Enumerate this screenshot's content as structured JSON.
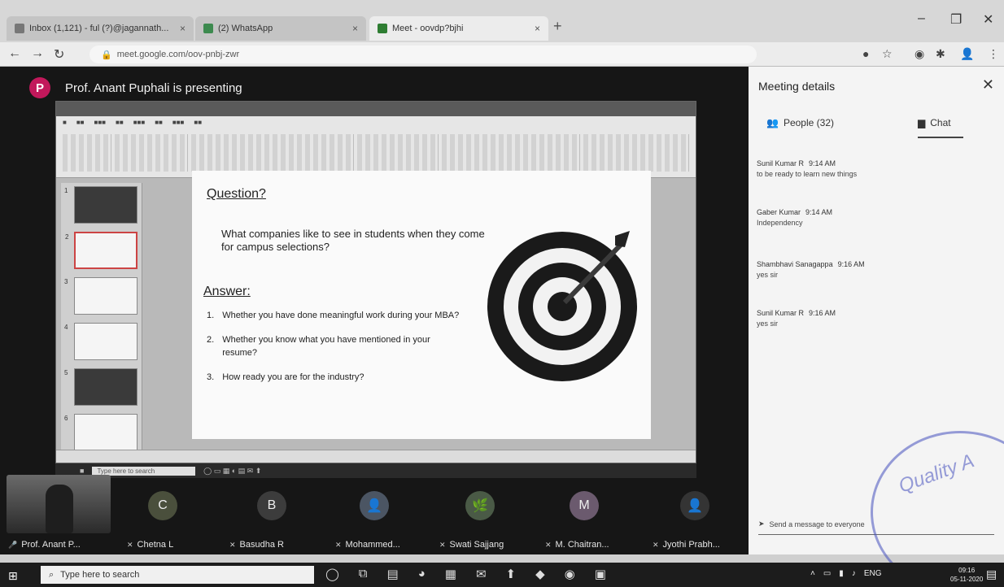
{
  "browser": {
    "tabs": [
      {
        "label": "Inbox (1,121) - ful (?)@jagannath...",
        "active": false
      },
      {
        "label": "(2) WhatsApp",
        "active": false
      },
      {
        "label": "Meet - oovdp?bjhi",
        "active": true
      }
    ],
    "url": "meet.google.com/oov-pnbj-zwr"
  },
  "meet": {
    "presenter_initial": "P",
    "presenter_color": "#c2185b",
    "presenting_text": "Prof. Anant Puphali is presenting"
  },
  "slide": {
    "question_heading": "Question?",
    "question_text": "What companies like to see in students when they come for campus selections?",
    "answer_heading": "Answer:",
    "answers": [
      {
        "num": "1.",
        "text": "Whether you have done meaningful work during your MBA?"
      },
      {
        "num": "2.",
        "text": "Whether you know what you have mentioned in your resume?"
      },
      {
        "num": "3.",
        "text": "How ready you are for the industry?"
      }
    ],
    "remote_search": "Type here to search"
  },
  "participants": [
    {
      "name": "Prof. Anant P...",
      "initial": "",
      "color": "#3a3a3a"
    },
    {
      "name": "Chetna L",
      "initial": "C",
      "color": "#4a4f3c"
    },
    {
      "name": "Basudha R",
      "initial": "B",
      "color": "#3c3c3c"
    },
    {
      "name": "Mohammed...",
      "initial": "👤",
      "color": "#4b5563"
    },
    {
      "name": "Swati Sajjang",
      "initial": "🌿",
      "color": "#4a5a46"
    },
    {
      "name": "M. Chaitran...",
      "initial": "M",
      "color": "#6b5a6e"
    },
    {
      "name": "Jyothi Prabh...",
      "initial": "👤",
      "color": "#343434"
    }
  ],
  "panel": {
    "title": "Meeting details",
    "people_tab": "People (32)",
    "chat_tab": "Chat",
    "messages": [
      {
        "sender": "Sunil Kumar R",
        "time": "9:14 AM",
        "text": "to be ready to learn new things"
      },
      {
        "sender": "Gaber Kumar",
        "time": "9:14 AM",
        "text": "Independency"
      },
      {
        "sender": "Shambhavi Sanagappa",
        "time": "9:16 AM",
        "text": "yes sir"
      },
      {
        "sender": "Sunil Kumar R",
        "time": "9:16 AM",
        "text": "yes sir"
      }
    ],
    "input_placeholder": "Send a message to everyone"
  },
  "stamp": {
    "text": "Quality A"
  },
  "taskbar": {
    "search_placeholder": "Type here to search",
    "lang": "ENG",
    "time": "09:16",
    "date": "05-11-2020"
  }
}
